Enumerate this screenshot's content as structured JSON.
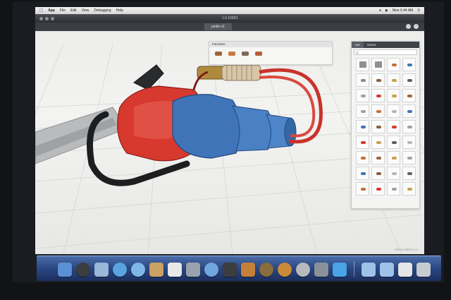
{
  "menubar": {
    "apple": "",
    "app": "App",
    "items": [
      "File",
      "Edit",
      "View",
      "Debugging",
      "Help"
    ],
    "clock": "Mon 5:44 AM"
  },
  "window": {
    "title": "1.0.15923"
  },
  "document_tab": "pintle-v1",
  "favorites": {
    "header": "Favorites"
  },
  "library": {
    "tabs": [
      "Set",
      "Stores"
    ],
    "search_placeholder": "Q"
  },
  "watermark": "TORCH BATCH-17",
  "colors": {
    "accent_red": "#d7392f",
    "accent_blue": "#3f74b8",
    "dock_blue": "#2c4a86"
  }
}
